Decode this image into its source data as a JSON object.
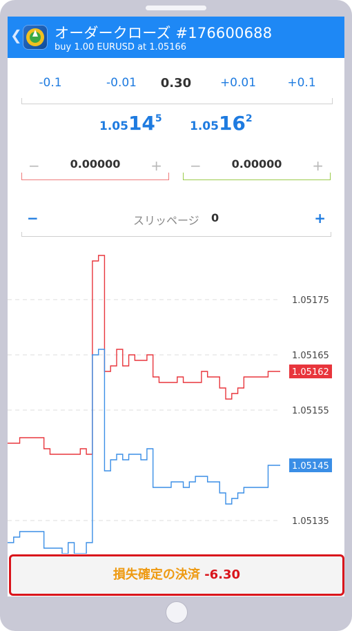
{
  "header": {
    "title": "オーダークローズ #176600688",
    "subtitle": "buy 1.00 EURUSD at 1.05166"
  },
  "volume": {
    "steps": [
      "-0.1",
      "-0.01",
      "0.30",
      "+0.01",
      "+0.1"
    ]
  },
  "prices": {
    "bid": {
      "big": "1.05",
      "pips": "14",
      "point": "5"
    },
    "ask": {
      "big": "1.05",
      "pips": "16",
      "point": "2"
    }
  },
  "stop_loss": {
    "minus": "−",
    "value": "0.00000",
    "plus": "+"
  },
  "take_profit": {
    "minus": "−",
    "value": "0.00000",
    "plus": "+"
  },
  "slippage": {
    "minus": "−",
    "label": "スリッページ",
    "value": "0",
    "plus": "+"
  },
  "chart_data": {
    "type": "line",
    "y_ticks": [
      "1.05175",
      "1.05165",
      "1.05155",
      "1.05135"
    ],
    "ylim": [
      1.05129,
      1.05185
    ],
    "grid": true,
    "series": [
      {
        "color": "#e8353c",
        "values": [
          1.05149,
          1.05149,
          1.0515,
          1.0515,
          1.0515,
          1.0515,
          1.05148,
          1.05147,
          1.05147,
          1.05147,
          1.05147,
          1.05147,
          1.05148,
          1.05147,
          1.05182,
          1.05183,
          1.05162,
          1.05163,
          1.05166,
          1.05163,
          1.05165,
          1.05164,
          1.05164,
          1.05165,
          1.05161,
          1.0516,
          1.0516,
          1.0516,
          1.05161,
          1.0516,
          1.0516,
          1.0516,
          1.05162,
          1.05161,
          1.05161,
          1.05159,
          1.05157,
          1.05158,
          1.05159,
          1.05161,
          1.05161,
          1.05161,
          1.05161,
          1.05162,
          1.05162,
          1.05162
        ]
      },
      {
        "color": "#3a8ee6",
        "values": [
          1.05131,
          1.05132,
          1.05133,
          1.05133,
          1.05133,
          1.05133,
          1.0513,
          1.0513,
          1.0513,
          1.05129,
          1.05131,
          1.05129,
          1.05129,
          1.05131,
          1.05165,
          1.05166,
          1.05144,
          1.05146,
          1.05147,
          1.05146,
          1.05147,
          1.05147,
          1.05146,
          1.05148,
          1.05141,
          1.05141,
          1.05141,
          1.05142,
          1.05142,
          1.05141,
          1.05142,
          1.05143,
          1.05143,
          1.05142,
          1.05142,
          1.0514,
          1.05138,
          1.05139,
          1.0514,
          1.05141,
          1.05141,
          1.05141,
          1.05141,
          1.05145,
          1.05145,
          1.05145
        ]
      }
    ],
    "labels": [
      {
        "text": "1.05162",
        "value": 1.05162,
        "color": "#e8353c"
      },
      {
        "text": "1.05145",
        "value": 1.05145,
        "color": "#3a8ee6"
      }
    ]
  },
  "close_button": {
    "label": "損失確定の決済",
    "amount": "-6.30"
  }
}
